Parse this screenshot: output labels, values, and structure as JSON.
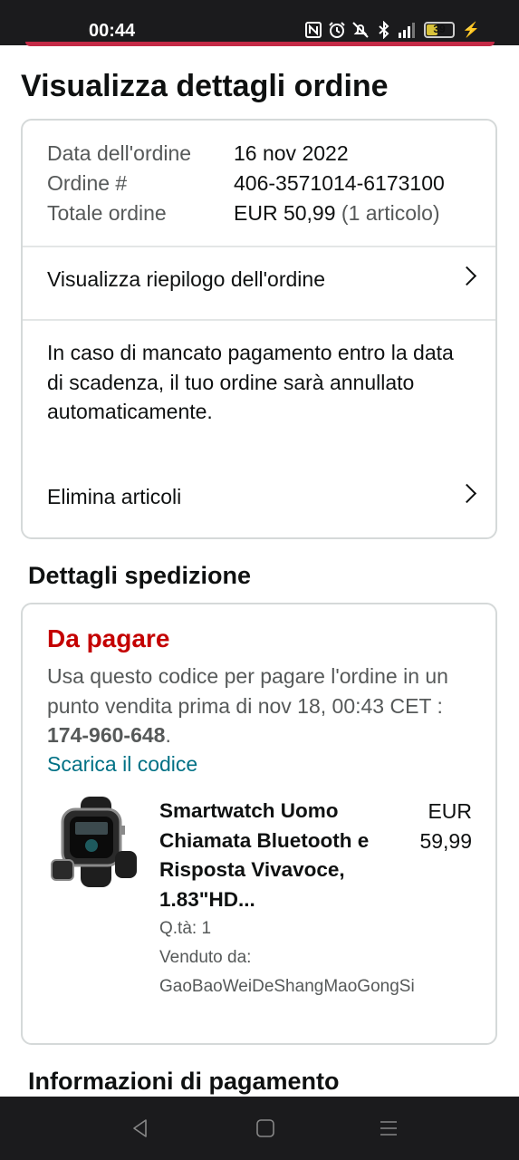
{
  "status_bar": {
    "time": "00:44",
    "battery": "39",
    "battery_level": 0.39,
    "icons": [
      "nfc-icon",
      "alarm-icon",
      "mute-icon",
      "bluetooth-icon",
      "4g-signal-icon",
      "battery-icon",
      "charging-icon"
    ]
  },
  "page": {
    "title": "Visualizza dettagli ordine"
  },
  "order": {
    "date_label": "Data dell'ordine",
    "date_value": "16 nov 2022",
    "number_label": "Ordine #",
    "number_value": "406-3571014-6173100",
    "total_label": "Totale ordine",
    "total_value": "EUR 50,99",
    "total_items": "(1 articolo)"
  },
  "summary_link": "Visualizza riepilogo dell'ordine",
  "cancel_notice": "In caso di mancato pagamento entro la data di scadenza, il tuo ordine sarà annullato automaticamente.",
  "delete_items": "Elimina articoli",
  "shipping": {
    "section_title": "Dettagli spedizione",
    "status": "Da pagare",
    "instructions": "Usa questo codice per pagare l'ordine in un punto vendita prima di nov 18, 00:43 CET :",
    "code": "174-960-648",
    "code_suffix": ".",
    "download_link": "Scarica il codice"
  },
  "product": {
    "title": "Smartwatch Uomo Chiamata Bluetooth e Risposta Vivavoce, 1.83\"HD...",
    "price_currency": "EUR",
    "price_value": "59,99",
    "quantity": "Q.tà: 1",
    "sold_by_label": "Venduto da:",
    "seller": "GaoBaoWeiDeShangMaoGongSi"
  },
  "payment_section_title": "Informazioni di pagamento",
  "colors": {
    "accent_red": "#c40000",
    "link": "#007185",
    "border": "#d5d9d9",
    "bar": "#1b1b1d"
  }
}
